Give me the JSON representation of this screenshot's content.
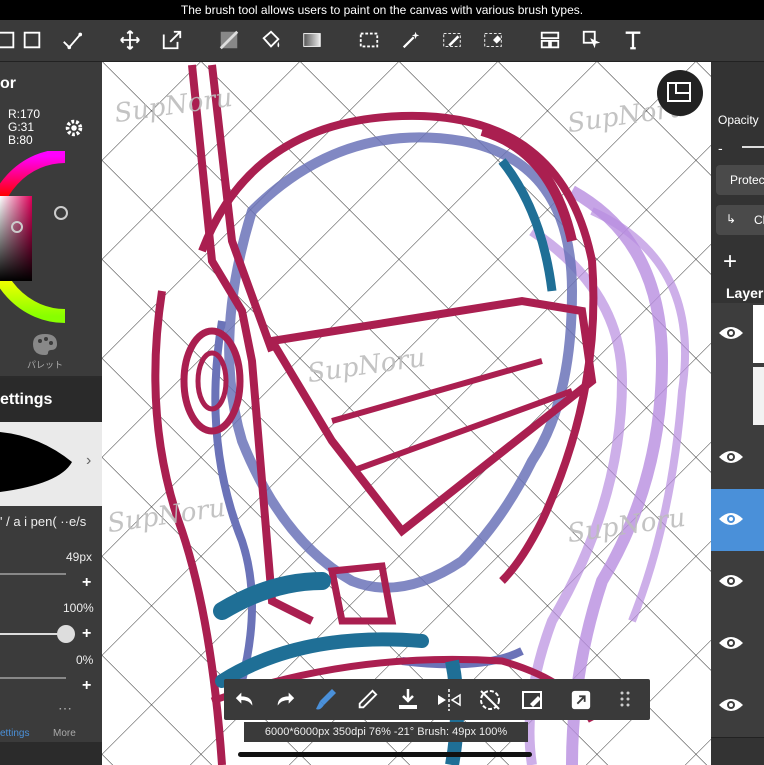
{
  "caption": "The brush tool allows users to paint on the canvas with various brush types.",
  "toolbar": {
    "tools": [
      "fill-square-icon",
      "frame-icon",
      "correction-icon",
      "move-icon",
      "transform-icon",
      "fill-icon",
      "bucket-icon",
      "gradient-icon",
      "select-icon",
      "magic-wand-icon",
      "select-pen-icon",
      "select-eraser-icon",
      "panel-icon",
      "pointer-icon",
      "text-icon"
    ]
  },
  "color": {
    "title": "or",
    "r": "R:170",
    "g": "G:31",
    "b": "B:80",
    "current_hex": "#aa1f50",
    "palette_label": "パレット"
  },
  "brush": {
    "header": "ettings",
    "name": "' / a i pen( ··e/s",
    "size": "49px",
    "opacity": "100%",
    "opacity_fraction": 1.0,
    "blur": "0%"
  },
  "tabs": {
    "settings": "ettings",
    "more": "More"
  },
  "layers": {
    "opacity_label": "Opacity",
    "protect_label": "Protec",
    "clip_label": "Cl",
    "layer_label": "Layer",
    "add": "+"
  },
  "status": "6000*6000px 350dpi 76% -21° Brush: 49px 100%",
  "watermark": "SupNoru",
  "colors": {
    "crimson": "#aa1f50",
    "blue": "#6b73b8",
    "teal": "#1f6f96",
    "purple": "#b88de0",
    "active_layer": "#4a90d9"
  }
}
